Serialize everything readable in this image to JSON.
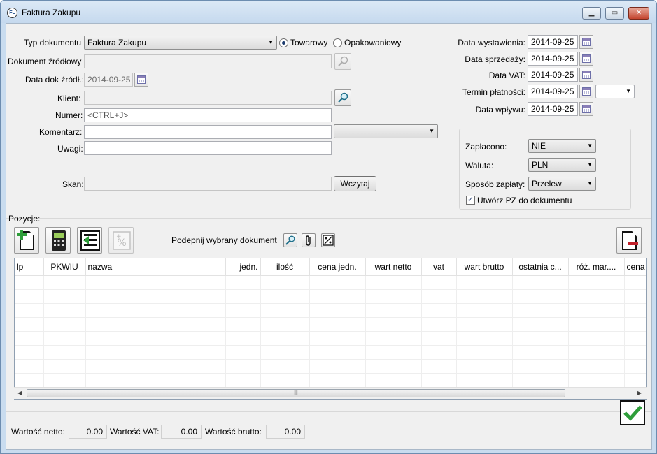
{
  "window": {
    "title": "Faktura Zakupu",
    "app_icon_text": "FL"
  },
  "form": {
    "typ_dokumentu": {
      "label": "Typ dokumentu",
      "value": "Faktura Zakupu"
    },
    "radio_towarowy": {
      "label": "Towarowy",
      "checked": true
    },
    "radio_opakowaniowy": {
      "label": "Opakowaniowy",
      "checked": false
    },
    "dokument_zrodlowy": {
      "label": "Dokument źródłowy",
      "value": ""
    },
    "data_dok_zrodl": {
      "label": "Data dok źródł.:",
      "value": "2014-09-25"
    },
    "klient": {
      "label": "Klient:",
      "value": ""
    },
    "numer": {
      "label": "Numer:",
      "value": "<CTRL+J>"
    },
    "komentarz": {
      "label": "Komentarz:",
      "value": "",
      "combo_value": ""
    },
    "uwagi": {
      "label": "Uwagi:",
      "value": ""
    },
    "skan": {
      "label": "Skan:",
      "value": "",
      "button": "Wczytaj"
    }
  },
  "dates": {
    "data_wystawienia": {
      "label": "Data wystawienia:",
      "value": "2014-09-25"
    },
    "data_sprzedazy": {
      "label": "Data sprzedaży:",
      "value": "2014-09-25"
    },
    "data_vat": {
      "label": "Data VAT:",
      "value": "2014-09-25"
    },
    "termin_platnosci": {
      "label": "Termin płatności:",
      "value": "2014-09-25",
      "combo_value": ""
    },
    "data_wplywu": {
      "label": "Data wpływu:",
      "value": "2014-09-25"
    }
  },
  "payment": {
    "zaplacono": {
      "label": "Zapłacono:",
      "value": "NIE"
    },
    "waluta": {
      "label": "Waluta:",
      "value": "PLN"
    },
    "sposob_zaplaty": {
      "label": "Sposób zapłaty:",
      "value": "Przelew"
    },
    "utworz_pz": {
      "label": "Utwórz PZ do dokumentu",
      "checked": true
    }
  },
  "pozycje": {
    "label": "Pozycje:",
    "podepnij_label": "Podepnij wybrany dokument",
    "columns": [
      "lp",
      "PKWIU",
      "nazwa",
      "jedn.",
      "ilość",
      "cena jedn.",
      "wart netto",
      "vat",
      "wart brutto",
      "ostatnia c...",
      "róż. mar....",
      "cena"
    ],
    "rows": [],
    "scroll_grip": "|||"
  },
  "totals": {
    "netto": {
      "label": "Wartość netto:",
      "value": "0.00"
    },
    "vat": {
      "label": "Wartość VAT:",
      "value": "0.00"
    },
    "brutto": {
      "label": "Wartość brutto:",
      "value": "0.00"
    }
  },
  "colors": {
    "accent_green": "#2e9e3a",
    "accent_red": "#c0202a",
    "window_frame": "#c9dcef"
  }
}
